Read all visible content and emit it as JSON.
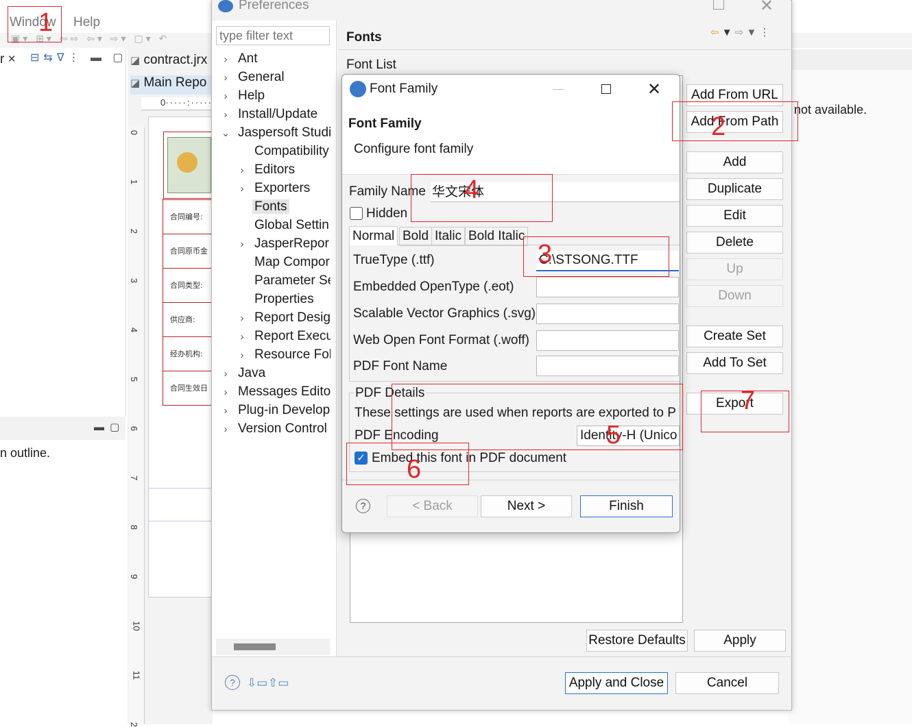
{
  "menubar": {
    "window": "Window",
    "help": "Help"
  },
  "left": {
    "tab_close": "×",
    "outline_text": "n outline."
  },
  "editor": {
    "file_tab": "contract.jrx",
    "report_tab": "Main Repo",
    "ruler_top": "0",
    "ruler_left": [
      "0",
      "1",
      "2",
      "3",
      "4",
      "5",
      "6",
      "7",
      "8",
      "9",
      "10",
      "11",
      "2"
    ],
    "doc_labels": [
      "合同编号:",
      "合同原币金",
      "合同类型:",
      "供应商:",
      "经办机构:",
      "合同生效日"
    ]
  },
  "bg_text": {
    "not_available": "not available."
  },
  "prefs": {
    "title": "Preferences",
    "filter_placeholder": "type filter text",
    "page_title": "Fonts",
    "font_list_label": "Font List",
    "tree": [
      {
        "label": "Ant",
        "indent": 0,
        "chev": "›"
      },
      {
        "label": "General",
        "indent": 0,
        "chev": "›"
      },
      {
        "label": "Help",
        "indent": 0,
        "chev": "›"
      },
      {
        "label": "Install/Update",
        "indent": 0,
        "chev": "›"
      },
      {
        "label": "Jaspersoft Studi",
        "indent": 0,
        "chev": "⌄"
      },
      {
        "label": "Compatibility",
        "indent": 1,
        "chev": ""
      },
      {
        "label": "Editors",
        "indent": 1,
        "chev": "›"
      },
      {
        "label": "Exporters",
        "indent": 1,
        "chev": "›"
      },
      {
        "label": "Fonts",
        "indent": 1,
        "chev": "",
        "selected": true
      },
      {
        "label": "Global Settin",
        "indent": 1,
        "chev": ""
      },
      {
        "label": "JasperRepor",
        "indent": 1,
        "chev": "›"
      },
      {
        "label": "Map Compor",
        "indent": 1,
        "chev": ""
      },
      {
        "label": "Parameter Se",
        "indent": 1,
        "chev": ""
      },
      {
        "label": "Properties",
        "indent": 1,
        "chev": ""
      },
      {
        "label": "Report Desig",
        "indent": 1,
        "chev": "›"
      },
      {
        "label": "Report Execu",
        "indent": 1,
        "chev": "›"
      },
      {
        "label": "Resource Fol",
        "indent": 1,
        "chev": "›"
      },
      {
        "label": "Java",
        "indent": 0,
        "chev": "›"
      },
      {
        "label": "Messages Editor",
        "indent": 0,
        "chev": "›"
      },
      {
        "label": "Plug-in Develop",
        "indent": 0,
        "chev": "›"
      },
      {
        "label": "Version Control",
        "indent": 0,
        "chev": "›"
      }
    ],
    "side_buttons": {
      "add_from_url": "Add From URL",
      "add_from_path": "Add From Path",
      "add": "Add",
      "duplicate": "Duplicate",
      "edit": "Edit",
      "delete": "Delete",
      "up": "Up",
      "down": "Down",
      "create_set": "Create Set",
      "add_to_set": "Add To Set",
      "export": "Export"
    },
    "restore_defaults": "Restore Defaults",
    "apply": "Apply",
    "apply_and_close": "Apply and Close",
    "cancel": "Cancel"
  },
  "dialog": {
    "title": "Font Family",
    "header_title": "Font Family",
    "header_desc": "Configure font family",
    "family_name_label": "Family Name",
    "family_name_value": "华文宋体",
    "hidden_label": "Hidden",
    "hidden_checked": false,
    "tabs": [
      "Normal",
      "Bold",
      "Italic",
      "Bold Italic"
    ],
    "active_tab": "Normal",
    "truetype_label": "TrueType (.ttf)",
    "truetype_value": "C:\\STSONG.TTF",
    "eot_label": "Embedded OpenType (.eot)",
    "svg_label": "Scalable Vector Graphics (.svg)",
    "woff_label": "Web Open Font Format (.woff)",
    "pdf_font_name_label": "PDF Font Name",
    "pdf_details_label": "PDF Details",
    "pdf_details_desc": "These settings are used when reports are exported to P",
    "pdf_encoding_label": "PDF Encoding",
    "pdf_encoding_value": "Identity-H (Unico",
    "embed_label": "Embed this font in PDF document",
    "embed_checked": true,
    "back": "< Back",
    "next": "Next >",
    "finish": "Finish"
  },
  "annotations": [
    "1",
    "2",
    "3",
    "4",
    "5",
    "6",
    "7"
  ],
  "colors": {
    "accent": "#1f6fce",
    "annotation": "#e0262a",
    "selected_bg": "#e5e5e5"
  }
}
